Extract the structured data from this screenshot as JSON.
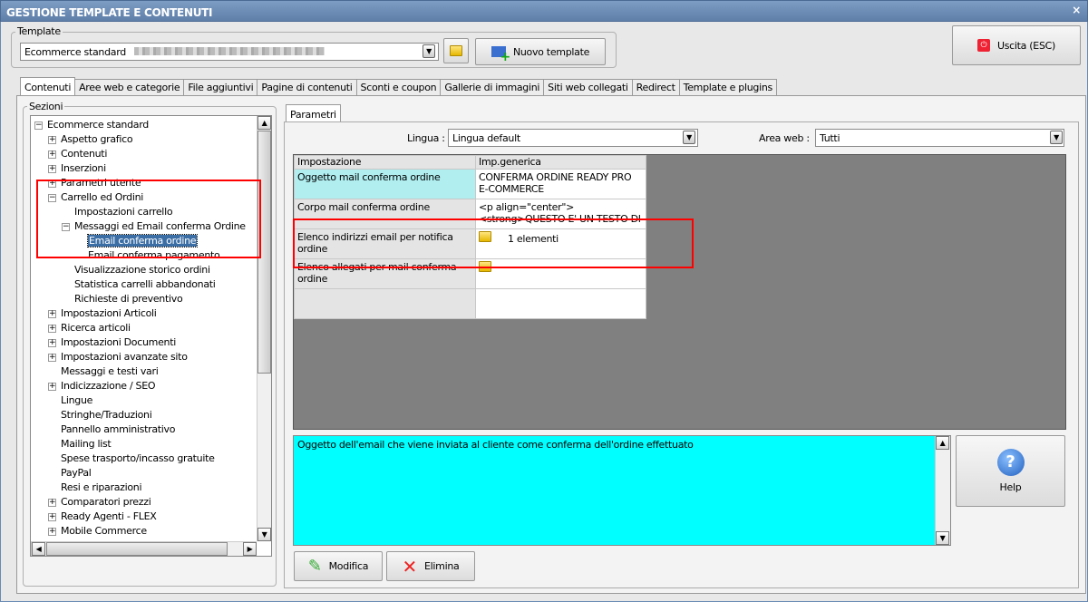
{
  "window": {
    "title": "GESTIONE TEMPLATE E CONTENUTI",
    "close": "×"
  },
  "template": {
    "legend": "Template",
    "selected": "Ecommerce standard",
    "new_button": "Nuovo template"
  },
  "exit_button": "Uscita (ESC)",
  "tabs": [
    "Contenuti",
    "Aree web e categorie",
    "File aggiuntivi",
    "Pagine di contenuti",
    "Sconti e coupon",
    "Gallerie di immagini",
    "Siti web collegati",
    "Redirect",
    "Template e plugins"
  ],
  "sections": {
    "legend": "Sezioni",
    "items": [
      {
        "label": "Ecommerce standard",
        "level": 0,
        "exp": "-"
      },
      {
        "label": "Aspetto grafico",
        "level": 1,
        "exp": "+"
      },
      {
        "label": "Contenuti",
        "level": 1,
        "exp": "+"
      },
      {
        "label": "Inserzioni",
        "level": 1,
        "exp": "+"
      },
      {
        "label": "Parametri utente",
        "level": 1,
        "exp": "+"
      },
      {
        "label": "Carrello ed Ordini",
        "level": 1,
        "exp": "-"
      },
      {
        "label": "Impostazioni carrello",
        "level": 2,
        "exp": ""
      },
      {
        "label": "Messaggi ed Email conferma Ordine",
        "level": 2,
        "exp": "-"
      },
      {
        "label": "Email conferma ordine",
        "level": 3,
        "exp": "",
        "selected": true
      },
      {
        "label": "Email conferma pagamento",
        "level": 3,
        "exp": ""
      },
      {
        "label": "Visualizzazione storico ordini",
        "level": 2,
        "exp": ""
      },
      {
        "label": "Statistica carrelli abbandonati",
        "level": 2,
        "exp": ""
      },
      {
        "label": "Richieste di preventivo",
        "level": 2,
        "exp": ""
      },
      {
        "label": "Impostazioni Articoli",
        "level": 1,
        "exp": "+"
      },
      {
        "label": "Ricerca articoli",
        "level": 1,
        "exp": "+"
      },
      {
        "label": "Impostazioni Documenti",
        "level": 1,
        "exp": "+"
      },
      {
        "label": "Impostazioni avanzate sito",
        "level": 1,
        "exp": "+"
      },
      {
        "label": "Messaggi e testi vari",
        "level": 1,
        "exp": ""
      },
      {
        "label": "Indicizzazione / SEO",
        "level": 1,
        "exp": "+"
      },
      {
        "label": "Lingue",
        "level": 1,
        "exp": ""
      },
      {
        "label": "Stringhe/Traduzioni",
        "level": 1,
        "exp": ""
      },
      {
        "label": "Pannello amministrativo",
        "level": 1,
        "exp": ""
      },
      {
        "label": "Mailing list",
        "level": 1,
        "exp": ""
      },
      {
        "label": "Spese trasporto/incasso gratuite",
        "level": 1,
        "exp": ""
      },
      {
        "label": "PayPal",
        "level": 1,
        "exp": ""
      },
      {
        "label": "Resi e riparazioni",
        "level": 1,
        "exp": ""
      },
      {
        "label": "Comparatori prezzi",
        "level": 1,
        "exp": "+"
      },
      {
        "label": "Ready Agenti - FLEX",
        "level": 1,
        "exp": "+"
      },
      {
        "label": "Mobile Commerce",
        "level": 1,
        "exp": "+"
      }
    ]
  },
  "params": {
    "tab": "Parametri",
    "lingua_label": "Lingua :",
    "lingua": "Lingua default",
    "area_label": "Area web :",
    "area": "Tutti",
    "columns": [
      "Impostazione",
      "Imp.generica"
    ],
    "rows": [
      {
        "name": "Oggetto mail conferma ordine",
        "value": "CONFERMA ORDINE READY PRO E-COMMERCE"
      },
      {
        "name": "Corpo mail conferma ordine",
        "value": "<p align=\"center\"> <strong>QUESTO E' UN TESTO DI"
      },
      {
        "name": "Elenco indirizzi email per notifica ordine",
        "value": "1 elementi",
        "icon": "folder-icon"
      },
      {
        "name": "Elenco allegati per mail conferma ordine",
        "value": "",
        "icon": "folder-icon"
      },
      {
        "name": "",
        "value": ""
      }
    ]
  },
  "description": "Oggetto dell'email che viene inviata al cliente come conferma dell'ordine effettuato",
  "help_button": "Help",
  "edit_button": "Modifica",
  "delete_button": "Elimina",
  "colors": {
    "title": "#6d8db8",
    "highlight": "#b0eef0",
    "description": "#00ffff",
    "selection": "#3b6ea5",
    "annotation": "#ff0000"
  }
}
